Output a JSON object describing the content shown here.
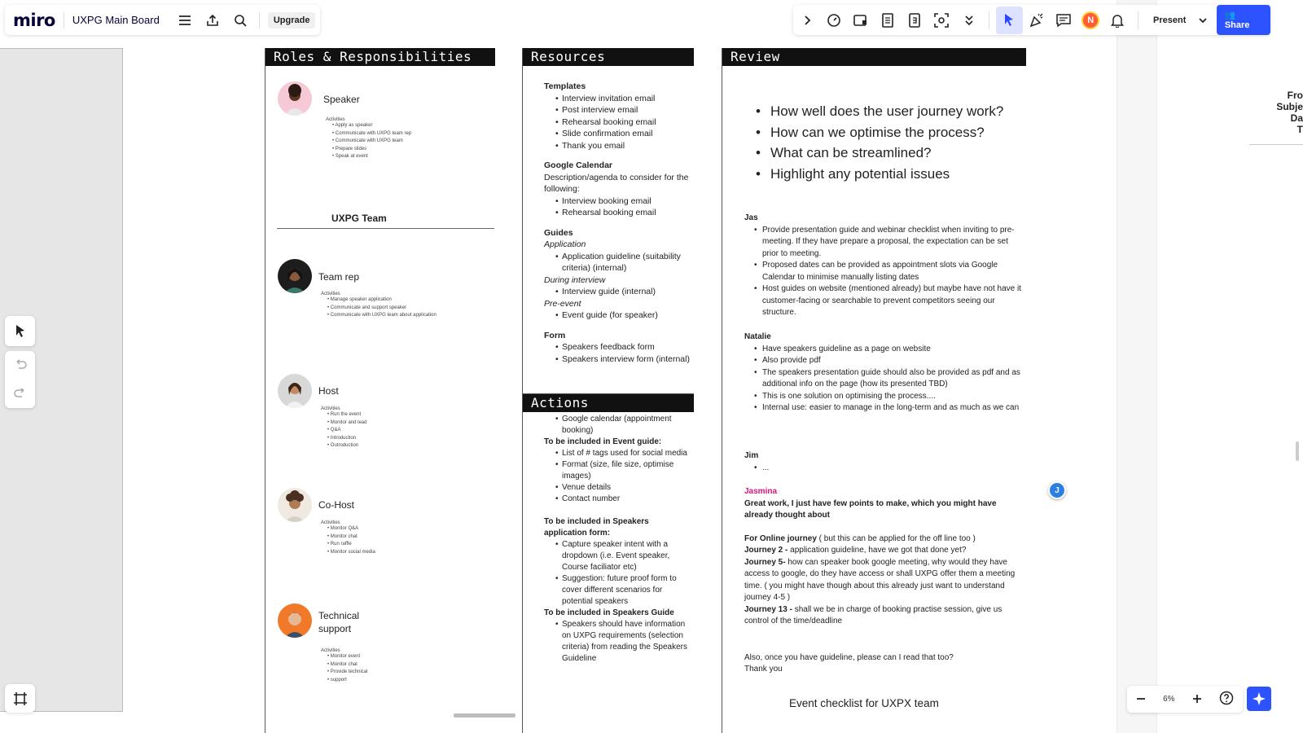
{
  "app": {
    "logo": "miro",
    "board_name": "UXPG Main Board",
    "upgrade_label": "Upgrade",
    "present_label": "Present",
    "share_label": "Share",
    "user_initial": "N",
    "zoom": "6%",
    "cursor_initial": "J",
    "accent": "#2d52ff",
    "icons_left": [
      "menu-icon",
      "export-icon",
      "search-icon"
    ],
    "icons_right": [
      "chevron-right-icon",
      "timer-icon",
      "card-icon",
      "doc-icon",
      "calc-icon",
      "focus-icon",
      "chevrons-down-icon",
      "cursor-icon",
      "celebrate-icon",
      "comment-icon",
      "bell-icon"
    ]
  },
  "roles": {
    "title": "Roles & Responsibilities",
    "team_heading": "UXPG Team",
    "activities_label": "Activities",
    "items": [
      {
        "name": "Speaker",
        "activities": [
          "Apply as speaker",
          "Communicate with UXPG team rep",
          "Communicate with UXPG team",
          "Prepare slides",
          "Speak at event"
        ]
      },
      {
        "name": "Team rep",
        "activities": [
          "Manage speaker application",
          "Communicate and support speaker",
          "Communicate with UXPG team about application"
        ]
      },
      {
        "name": "Host",
        "activities": [
          "Run the event",
          "Monitor and lead",
          "Q&A",
          "Introduction",
          "Outroduction"
        ]
      },
      {
        "name": "Co-Host",
        "activities": [
          "Monitor Q&A",
          "Monitor chat",
          "Run raffle",
          "Monitor social media"
        ]
      },
      {
        "name": "Technical support",
        "activities": [
          "Monitor event",
          "Monitor chat",
          "Provide technical",
          "support"
        ]
      }
    ]
  },
  "resources": {
    "title": "Resources",
    "templates_heading": "Templates",
    "templates": [
      "Interview invitation email",
      "Post interview email",
      "Rehearsal booking email",
      "Slide confirmation email",
      "Thank you email"
    ],
    "calendar_heading": "Google Calendar",
    "calendar_desc": "Description/agenda to consider for the following:",
    "calendar_items": [
      "Interview booking email",
      "Rehearsal booking email"
    ],
    "guides_heading": "Guides",
    "guides_application": "Application",
    "guides_application_items": [
      "Application guideline (suitability criteria) (internal)"
    ],
    "guides_during": "During interview",
    "guides_during_items": [
      "Interview guide (internal)"
    ],
    "guides_pre": "Pre-event",
    "guides_pre_items": [
      "Event guide (for speaker)"
    ],
    "form_heading": "Form",
    "form_items": [
      "Speakers feedback form",
      "Speakers interview form (internal)"
    ]
  },
  "actions": {
    "title": "Actions",
    "first_items": [
      "Google calendar (appointment booking)"
    ],
    "event_guide_heading": "To be included in Event guide:",
    "event_guide_items": [
      "List of # tags used for social media",
      "Format (size, file size, optimise images)",
      "Venue details",
      "Contact number"
    ],
    "app_form_heading": "To be included in Speakers application form:",
    "app_form_items": [
      "Capture speaker intent with a dropdown (i.e. Event speaker, Course faciliator etc)",
      "Suggestion: future proof form to cover different scenarios for potential speakers"
    ],
    "speakers_guide_heading": "To be included in Speakers Guide",
    "speakers_guide_items": [
      "Speakers should have information on UXPG requirements (selection criteria) from reading the Speakers Guideline"
    ]
  },
  "review": {
    "title": "Review",
    "questions": [
      "How well does the user journey work?",
      "How can we optimise the process?",
      "What can be streamlined?",
      "Highlight any potential issues"
    ],
    "jas_name": "Jas",
    "jas_items": [
      "Provide presentation guide and webinar checklist when inviting to pre-meeting. If they have prepare a proposal, the expectation can be set prior to meeting.",
      "Proposed dates can be provided as appointment slots via Google Calendar to minimise manually listing dates",
      "Host guides on website (mentioned already) but maybe have not have it customer-facing or searchable to prevent competitors seeing our structure."
    ],
    "natalie_name": "Natalie",
    "natalie_items": [
      "Have speakers guideline as a page on website",
      "Also provide pdf",
      "The speakers presentation guide should also be provided as pdf and as additional info on the page (how its presented TBD)",
      "This is one solution on optimising the process....",
      "Internal use: easier to manage in the long-term and as much as we can"
    ],
    "jim_name": "Jim",
    "jim_items": [
      "..."
    ],
    "jasmina_name": "Jasmina",
    "jasmina_intro": "Great work, I just have few points to make, which you might have already thought about",
    "online_label": "For Online journey",
    "online_text": " ( but this can be applied for the off line too )",
    "j2_label": "Journey 2 -",
    "j2_text": " application guideline, have we got that done yet?",
    "j5_label": "Journey 5-",
    "j5_text": " how can speaker book google meeting, why would they have access to google, do they have access or shall UXPG offer them a meeting time. ( you might have though about this already just want to understand journey 4-5 )",
    "j13_label": "Journey 13 -",
    "j13_text": " shall we be in charge of booking practise session, give us control of the  time/deadline",
    "closing": "Also, once you have guideline, please can I read that too?",
    "thanks": "Thank you",
    "checklist_title": "Event checklist for UXPX team"
  },
  "offscreen": {
    "text_lines": [
      "Fro",
      "Subje",
      "Da",
      "T"
    ]
  }
}
